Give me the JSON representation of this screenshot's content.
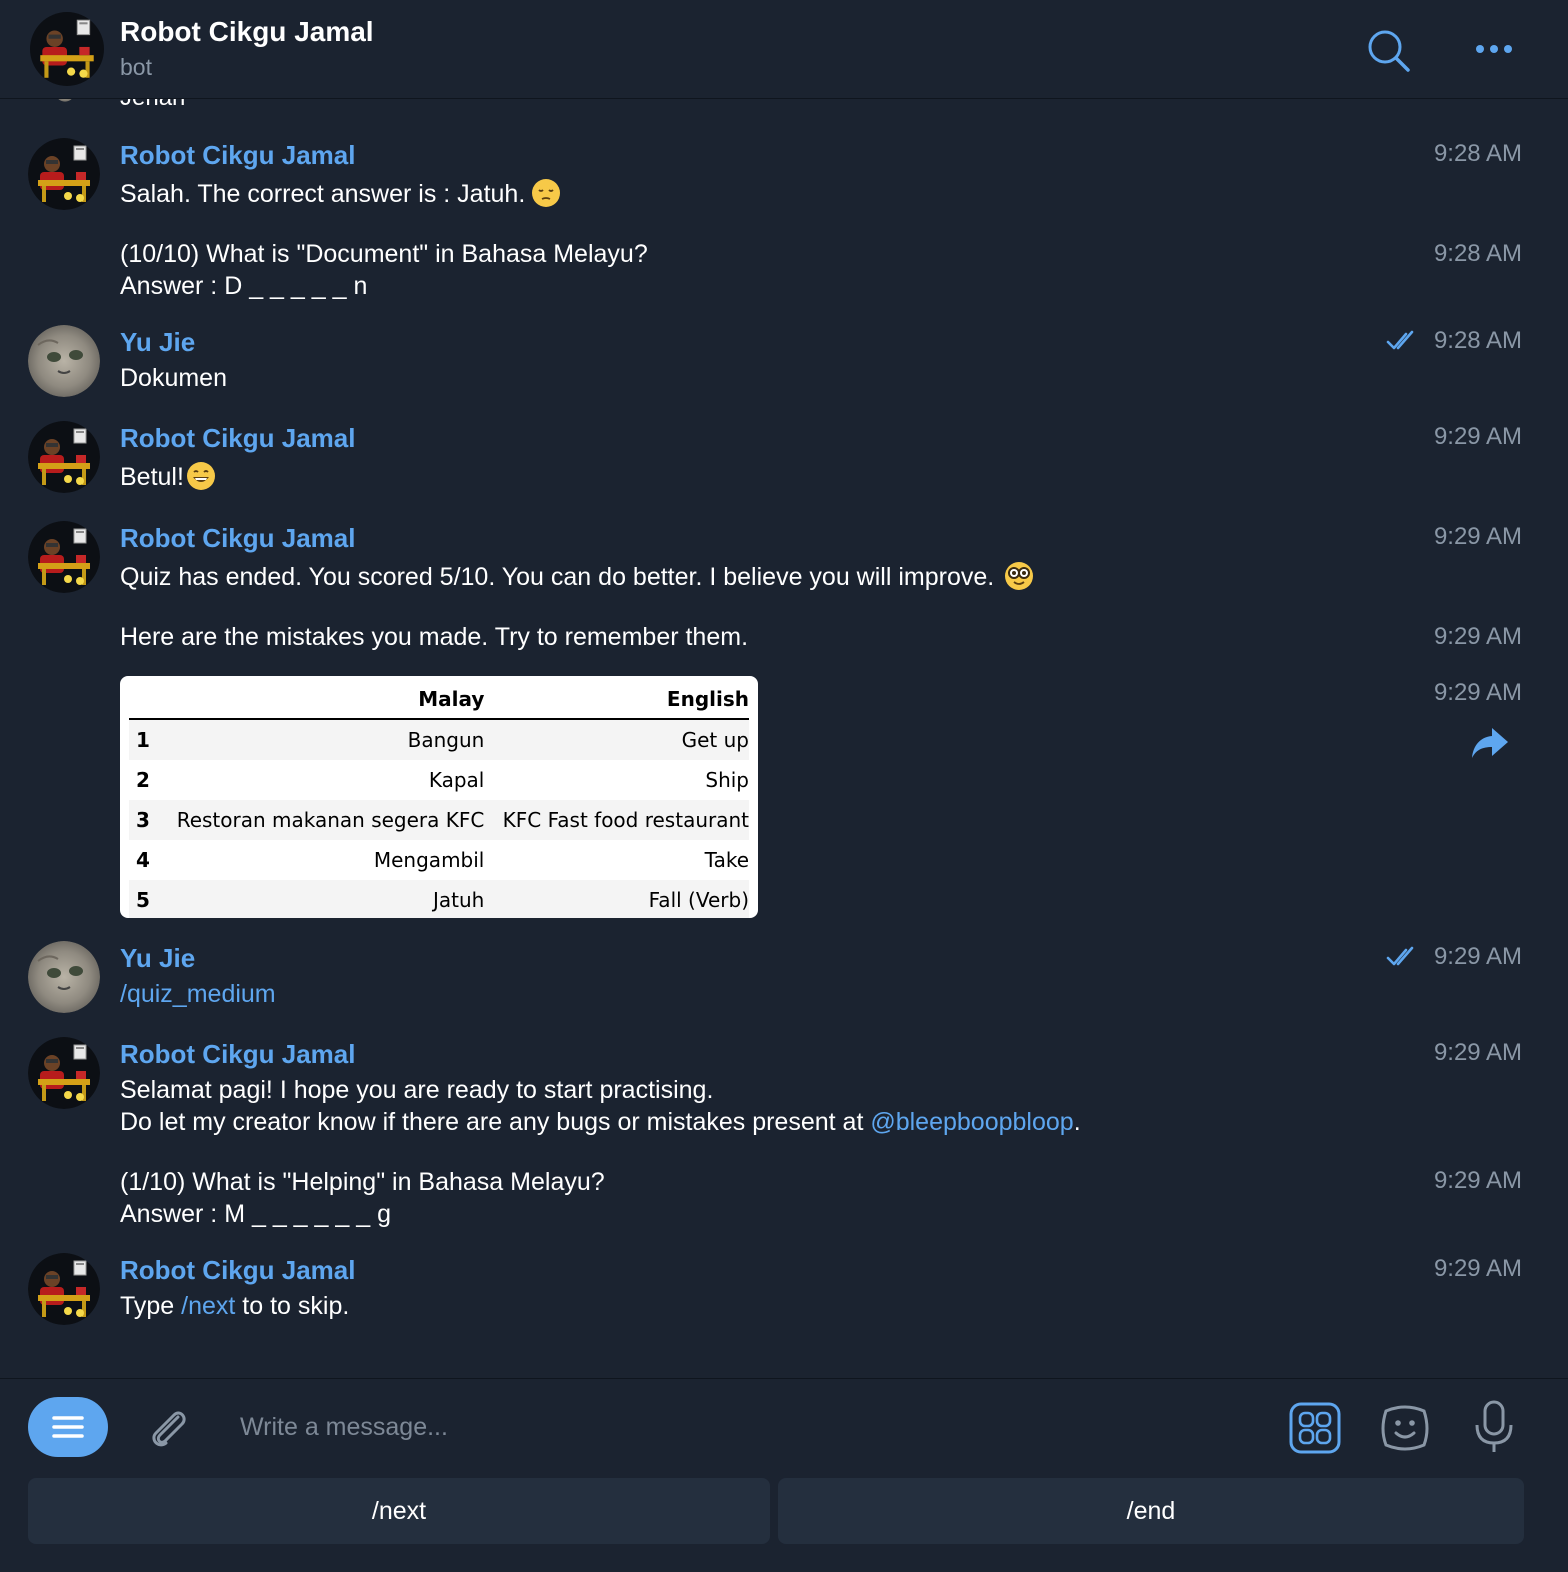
{
  "header": {
    "title": "Robot Cikgu Jamal",
    "subtitle": "bot"
  },
  "partial_message": {
    "text": "Jenah"
  },
  "messages": [
    {
      "sender": "Robot Cikgu Jamal",
      "text": "Salah. The correct answer is : Jatuh.",
      "emoji": "pensive-face",
      "time": "9:28 AM"
    },
    {
      "line1": "(10/10) What is \"Document\" in Bahasa Melayu?",
      "line2": "Answer : D _ _ _ _ _ n",
      "time": "9:28 AM"
    },
    {
      "sender": "Yu Jie",
      "text": "Dokumen",
      "time": "9:28 AM",
      "read": true
    },
    {
      "sender": "Robot Cikgu Jamal",
      "text": "Betul!",
      "emoji": "grinning-face",
      "time": "9:29 AM"
    },
    {
      "sender": "Robot Cikgu Jamal",
      "text": "Quiz has ended. You scored 5/10. You can do better. I believe you will improve.",
      "emoji": "nerd-face",
      "time": "9:29 AM"
    },
    {
      "text": "Here are the mistakes you made. Try to remember them.",
      "time": "9:29 AM"
    },
    {
      "time": "9:29 AM",
      "table": {
        "headers": [
          "",
          "Malay",
          "English"
        ],
        "rows": [
          [
            "1",
            "Bangun",
            "Get up"
          ],
          [
            "2",
            "Kapal",
            "Ship"
          ],
          [
            "3",
            "Restoran makanan segera KFC",
            "KFC Fast food restaurant"
          ],
          [
            "4",
            "Mengambil",
            "Take"
          ],
          [
            "5",
            "Jatuh",
            "Fall (Verb)"
          ]
        ]
      }
    },
    {
      "sender": "Yu Jie",
      "text": "/quiz_medium",
      "time": "9:29 AM",
      "read": true
    },
    {
      "sender": "Robot Cikgu Jamal",
      "line1": "Selamat pagi! I hope you are ready to start practising.",
      "line2_prefix": "Do let my creator know if there are any bugs or mistakes present at ",
      "line2_link": "@bleepboopbloop",
      "line2_suffix": ".",
      "time": "9:29 AM"
    },
    {
      "line1": "(1/10) What is \"Helping\" in Bahasa Melayu?",
      "line2": "Answer : M _ _ _ _ _ _ g",
      "time": "9:29 AM"
    },
    {
      "sender": "Robot Cikgu Jamal",
      "prefix": "Type ",
      "link": "/next",
      "suffix": " to to skip.",
      "time": "9:29 AM"
    }
  ],
  "composer": {
    "placeholder": "Write a message..."
  },
  "keyboard": {
    "buttons": [
      "/next",
      "/end"
    ]
  },
  "colors": {
    "background": "#1b2330",
    "accent": "#5ea6ef",
    "muted": "#8a97a6",
    "key": "#242f3e"
  },
  "icons": [
    "search-icon",
    "more-icon",
    "menu-icon",
    "attach-icon",
    "keyboard-icon",
    "sticker-icon",
    "mic-icon",
    "share-icon",
    "double-check-icon"
  ]
}
